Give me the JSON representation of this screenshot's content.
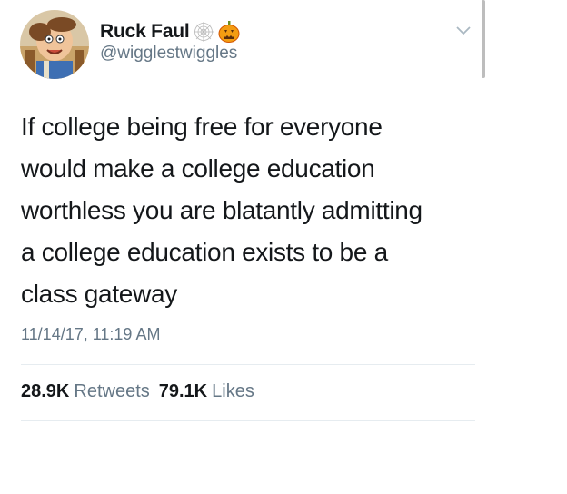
{
  "user": {
    "display_name": "Ruck Faul",
    "handle": "@wigglestwiggles",
    "name_emojis": [
      "spider-web-icon",
      "jack-o-lantern-icon"
    ]
  },
  "tweet": {
    "text_lines": [
      "If college being free for everyone",
      "would make a college education",
      "worthless you are blatantly admitting",
      "a college education exists to be a",
      "class gateway"
    ],
    "timestamp": "11/14/17, 11:19 AM"
  },
  "stats": {
    "retweets_count": "28.9K",
    "retweets_label": "Retweets",
    "likes_count": "79.1K",
    "likes_label": "Likes"
  },
  "colors": {
    "text_primary": "#14171a",
    "text_secondary": "#657786",
    "divider": "#e6ecf0"
  }
}
